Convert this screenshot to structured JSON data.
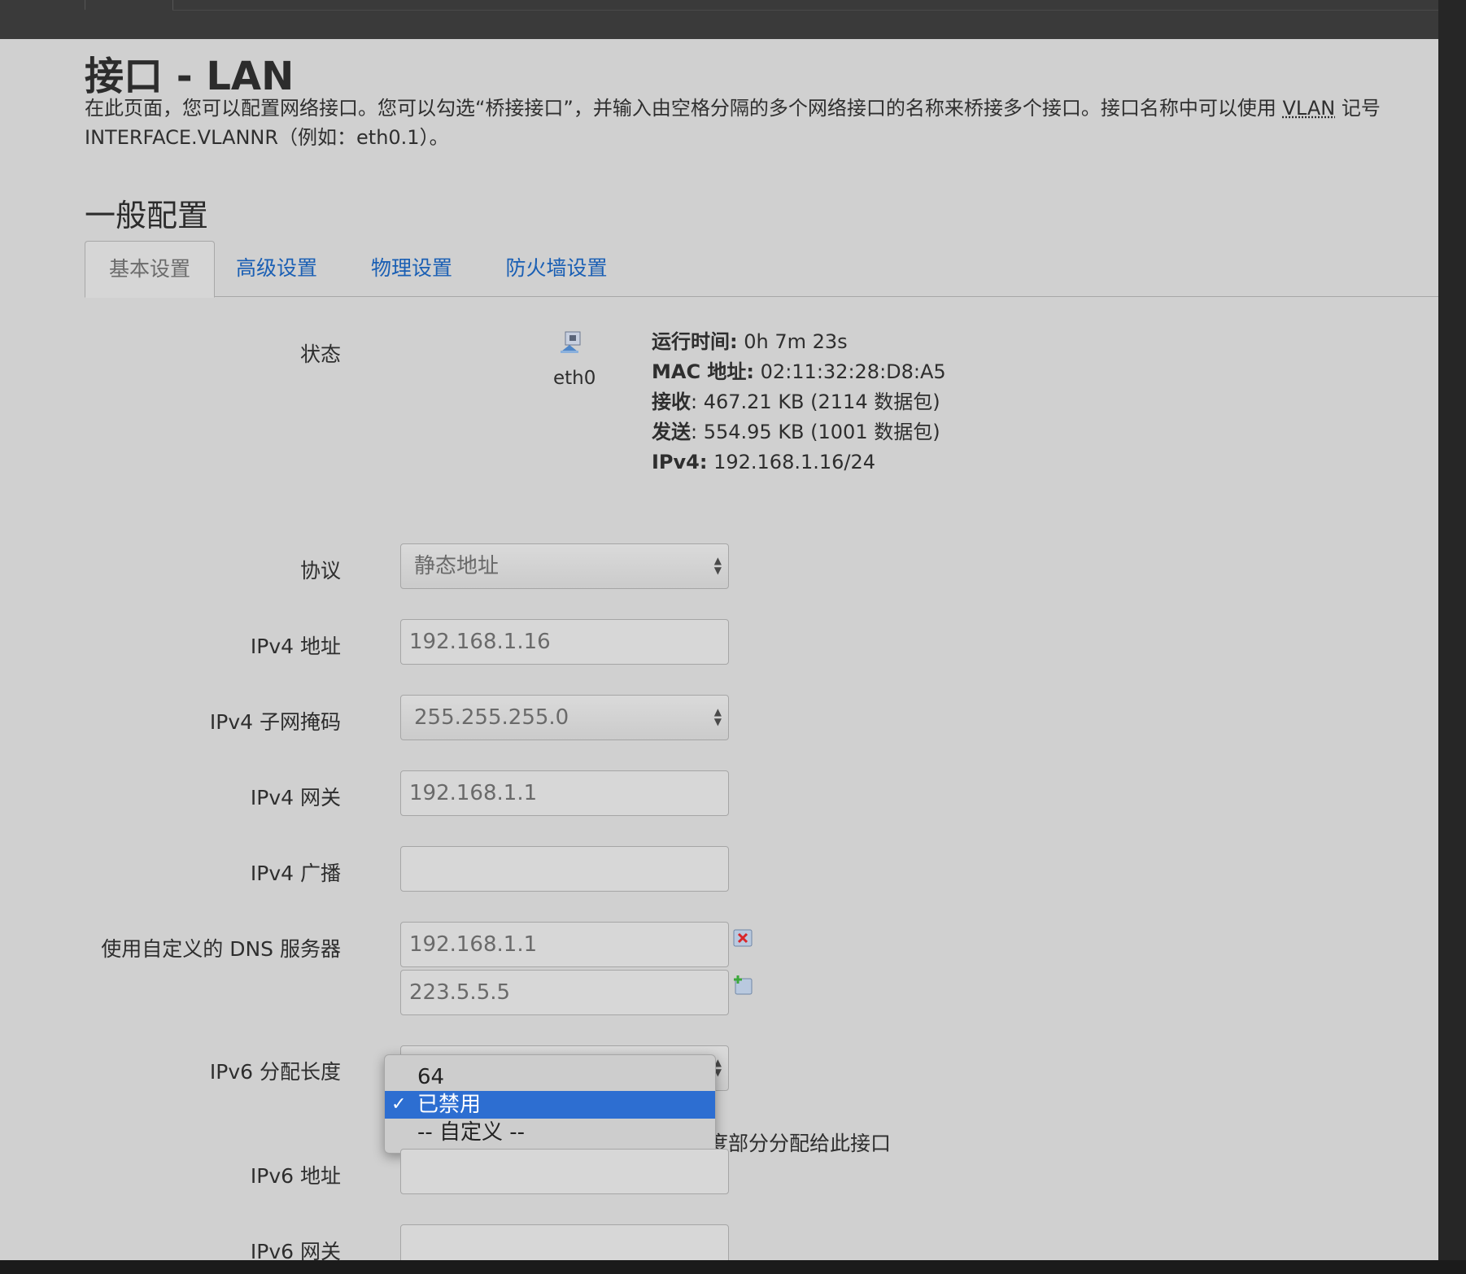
{
  "page": {
    "title": "接口 - LAN",
    "description_part1": "在此页面，您可以配置网络接口。您可以勾选“桥接接口”，并输入由空格分隔的多个网络接口的名称来桥接多个接口。接口名称中可以使用 ",
    "description_vlan": "VLAN",
    "description_part2": " 记号 INTERFACE.VLANNR（例如：eth0.1）。",
    "section_title": "一般配置"
  },
  "tabs": [
    "基本设置",
    "高级设置",
    "物理设置",
    "防火墙设置"
  ],
  "status": {
    "label": "状态",
    "interface": "eth0",
    "uptime_label": "运行时间:",
    "uptime_value": " 0h 7m 23s",
    "mac_label": "MAC 地址:",
    "mac_value": " 02:11:32:28:D8:A5",
    "rx_label": "接收",
    "rx_value": ": 467.21 KB (2114 数据包)",
    "tx_label": "发送",
    "tx_value": ": 554.95 KB (1001 数据包)",
    "ipv4_label": "IPv4:",
    "ipv4_value": " 192.168.1.16/24"
  },
  "form": {
    "protocol_label": "协议",
    "protocol_value": "静态地址",
    "ipv4_addr_label": "IPv4 地址",
    "ipv4_addr_value": "192.168.1.16",
    "netmask_label": "IPv4 子网掩码",
    "netmask_value": "255.255.255.0",
    "gateway_label": "IPv4 网关",
    "gateway_value": "192.168.1.1",
    "broadcast_label": "IPv4 广播",
    "broadcast_value": "",
    "dns_label": "使用自定义的 DNS 服务器",
    "dns_values": [
      "192.168.1.1",
      "223.5.5.5"
    ],
    "ipv6_assign_label": "IPv6 分配长度",
    "ipv6_assign_options": [
      "64",
      "已禁用",
      "-- 自定义 --"
    ],
    "ipv6_assign_selected": "已禁用",
    "ipv6_assign_checkmark": "✓",
    "ipv6_hint_visible": "度部分分配给此接口",
    "ipv6_addr_label": "IPv6 地址",
    "ipv6_gw_label": "IPv6 网关"
  }
}
